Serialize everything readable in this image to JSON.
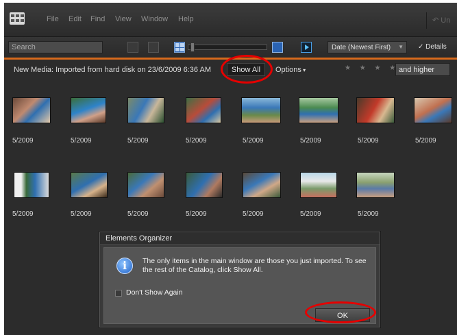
{
  "menu": {
    "items": [
      "File",
      "Edit",
      "Find",
      "View",
      "Window",
      "Help"
    ],
    "undo_label": "Un"
  },
  "toolbar": {
    "search_placeholder": "Search",
    "sort_value": "Date (Newest First)",
    "details_label": "Details"
  },
  "infobar": {
    "import_text": "New Media: Imported from hard disk on 23/6/2009 6:36 AM",
    "show_all_label": "Show All",
    "options_label": "Options",
    "stars": "★ ★ ★ ★ ★",
    "rating_filter": "and higher"
  },
  "thumbnails": [
    {
      "date": "5/2009"
    },
    {
      "date": "5/2009"
    },
    {
      "date": "5/2009"
    },
    {
      "date": "5/2009"
    },
    {
      "date": "5/2009"
    },
    {
      "date": "5/2009"
    },
    {
      "date": "5/2009"
    },
    {
      "date": "5/2009"
    },
    {
      "date": "5/2009"
    },
    {
      "date": "5/2009"
    },
    {
      "date": "5/2009"
    },
    {
      "date": "5/2009"
    },
    {
      "date": "5/2009"
    },
    {
      "date": "5/2009"
    },
    {
      "date": "5/2009"
    }
  ],
  "dialog": {
    "title": "Elements Organizer",
    "message": "The only items in the main window are those you just imported. To see the rest of the Catalog, click Show All.",
    "dont_show_label": "Don't Show Again",
    "ok_label": "OK"
  },
  "colors": {
    "accent": "#d86a1c",
    "highlight": "#e50000"
  }
}
